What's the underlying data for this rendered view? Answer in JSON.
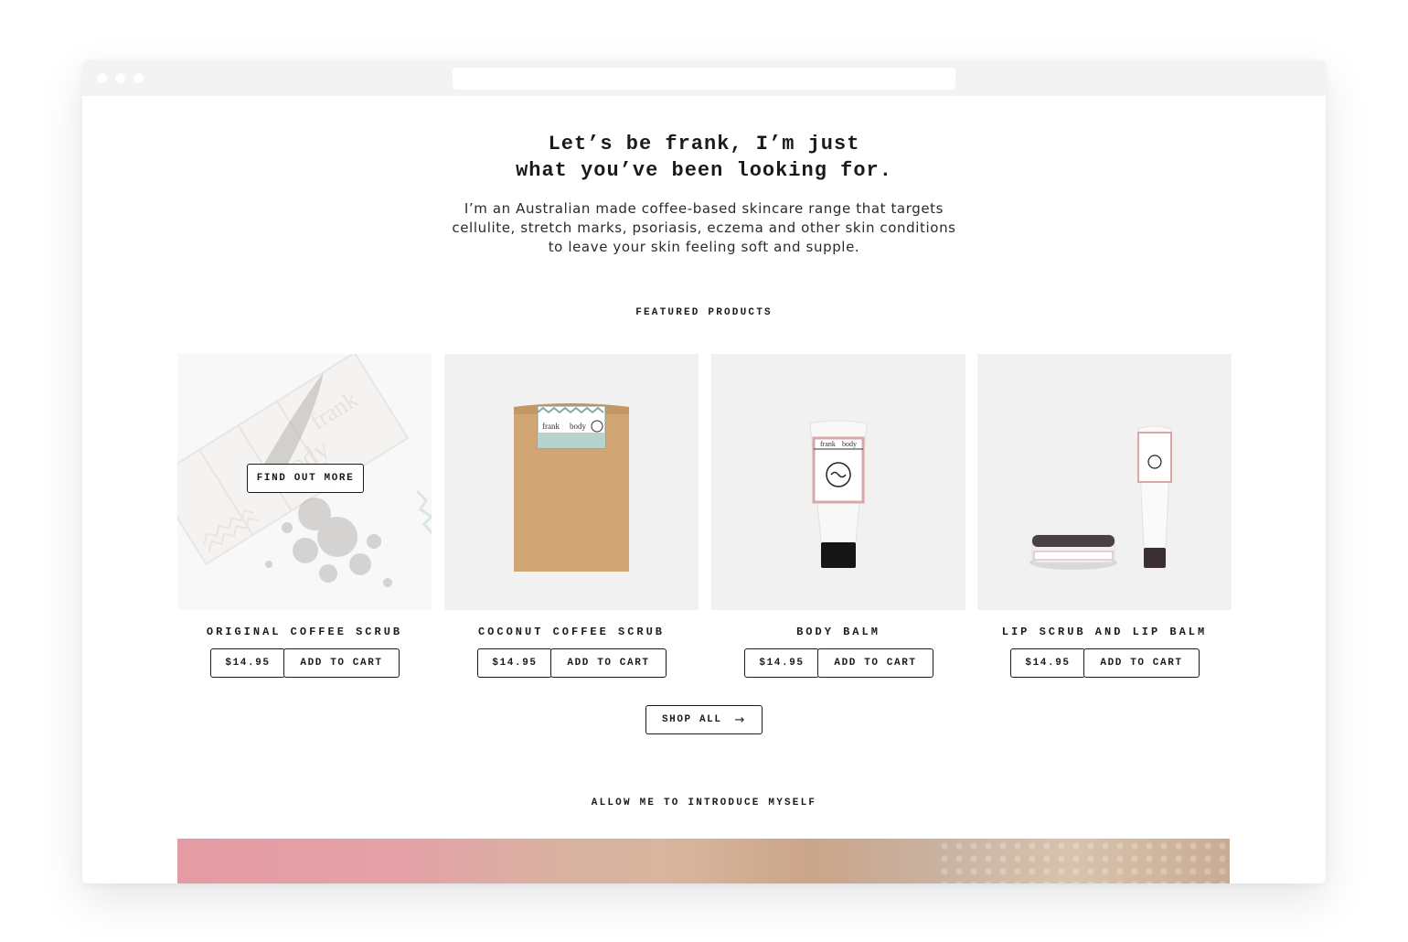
{
  "hero": {
    "headline_line1": "Let’s be frank, I’m just",
    "headline_line2": "what you’ve been looking for.",
    "intro_line1": "I’m an Australian made coffee-based skincare range that targets",
    "intro_line2": "cellulite, stretch marks, psoriasis, eczema and other skin conditions",
    "intro_line3": "to leave your skin feeling soft and supple."
  },
  "featured": {
    "label": "FEATURED PRODUCTS",
    "find_out_more": "FIND OUT MORE",
    "products": [
      {
        "name": "ORIGINAL COFFEE SCRUB",
        "price": "$14.95",
        "cta": "ADD TO CART",
        "image": "original-coffee-scrub-photo"
      },
      {
        "name": "COCONUT COFFEE SCRUB",
        "price": "$14.95",
        "cta": "ADD TO CART",
        "image": "coconut-coffee-scrub-pouch"
      },
      {
        "name": "BODY BALM",
        "price": "$14.95",
        "cta": "ADD TO CART",
        "image": "body-balm-tube"
      },
      {
        "name": "LIP SCRUB AND LIP BALM",
        "price": "$14.95",
        "cta": "ADD TO CART",
        "image": "lip-scrub-and-balm"
      }
    ],
    "shop_all": "SHOP ALL",
    "shop_all_icon": "arrow-right-icon"
  },
  "introduce": {
    "label": "ALLOW ME TO INTRODUCE MYSELF"
  },
  "colors": {
    "text": "#1a1a1a",
    "titlebar": "#f3f3f4",
    "product_bg": "#f1f1f1",
    "kraft": "#d2a674"
  }
}
